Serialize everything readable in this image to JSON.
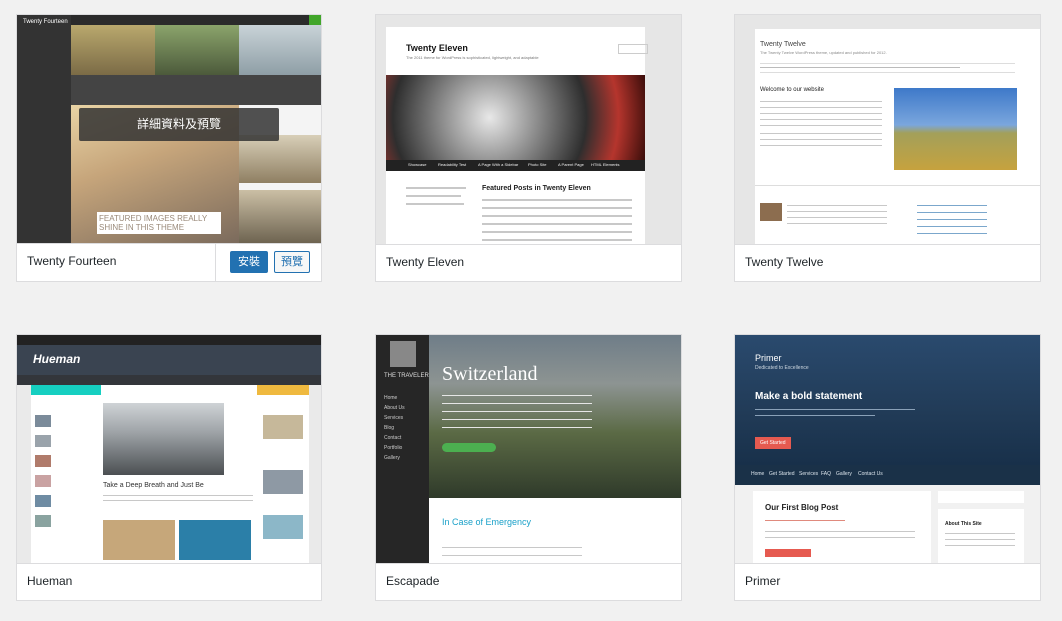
{
  "themes": [
    {
      "name": "Twenty Fourteen",
      "active_overlay": "詳細資料及預覽",
      "install_label": "安裝",
      "preview_label": "預覽",
      "shot": {
        "site_title": "Twenty Fourteen",
        "featured_caption": "FEATURED IMAGES REALLY SHINE IN THIS THEME"
      }
    },
    {
      "name": "Twenty Eleven",
      "shot": {
        "site_title": "Twenty Eleven",
        "tagline": "The 2011 theme for WordPress is sophisticated, lightweight, and adaptable",
        "nav": [
          "Showcase",
          "Readability Test",
          "A Page With a Sidebar",
          "Photo Site",
          "A Parent Page",
          "HTML Elements"
        ],
        "post_title": "Featured Posts in Twenty Eleven"
      }
    },
    {
      "name": "Twenty Twelve",
      "shot": {
        "site_title": "Twenty Twelve",
        "tagline": "The Twenty Twelve WordPress theme, updated and published for 2012.",
        "welcome": "Welcome to our website"
      }
    },
    {
      "name": "Hueman",
      "shot": {
        "logo": "Hueman",
        "post_title": "Take a Deep Breath and Just Be"
      }
    },
    {
      "name": "Escapade",
      "shot": {
        "logo": "THE TRAVELER",
        "hero_title": "Switzerland",
        "menu": [
          "Home",
          "About Us",
          "Services",
          "Blog",
          "Contact",
          "Portfolio",
          "Gallery"
        ],
        "post_title": "In Case of Emergency"
      }
    },
    {
      "name": "Primer",
      "shot": {
        "site_title": "Primer",
        "tagline": "Dedicated to Excellence",
        "hero_heading": "Make a bold statement",
        "cta": "Get Started",
        "nav": [
          "Home",
          "Get Started",
          "Services",
          "FAQ",
          "Gallery",
          "Contact Us"
        ],
        "post_title": "Our First Blog Post",
        "widget_title": "About This Site"
      }
    }
  ]
}
